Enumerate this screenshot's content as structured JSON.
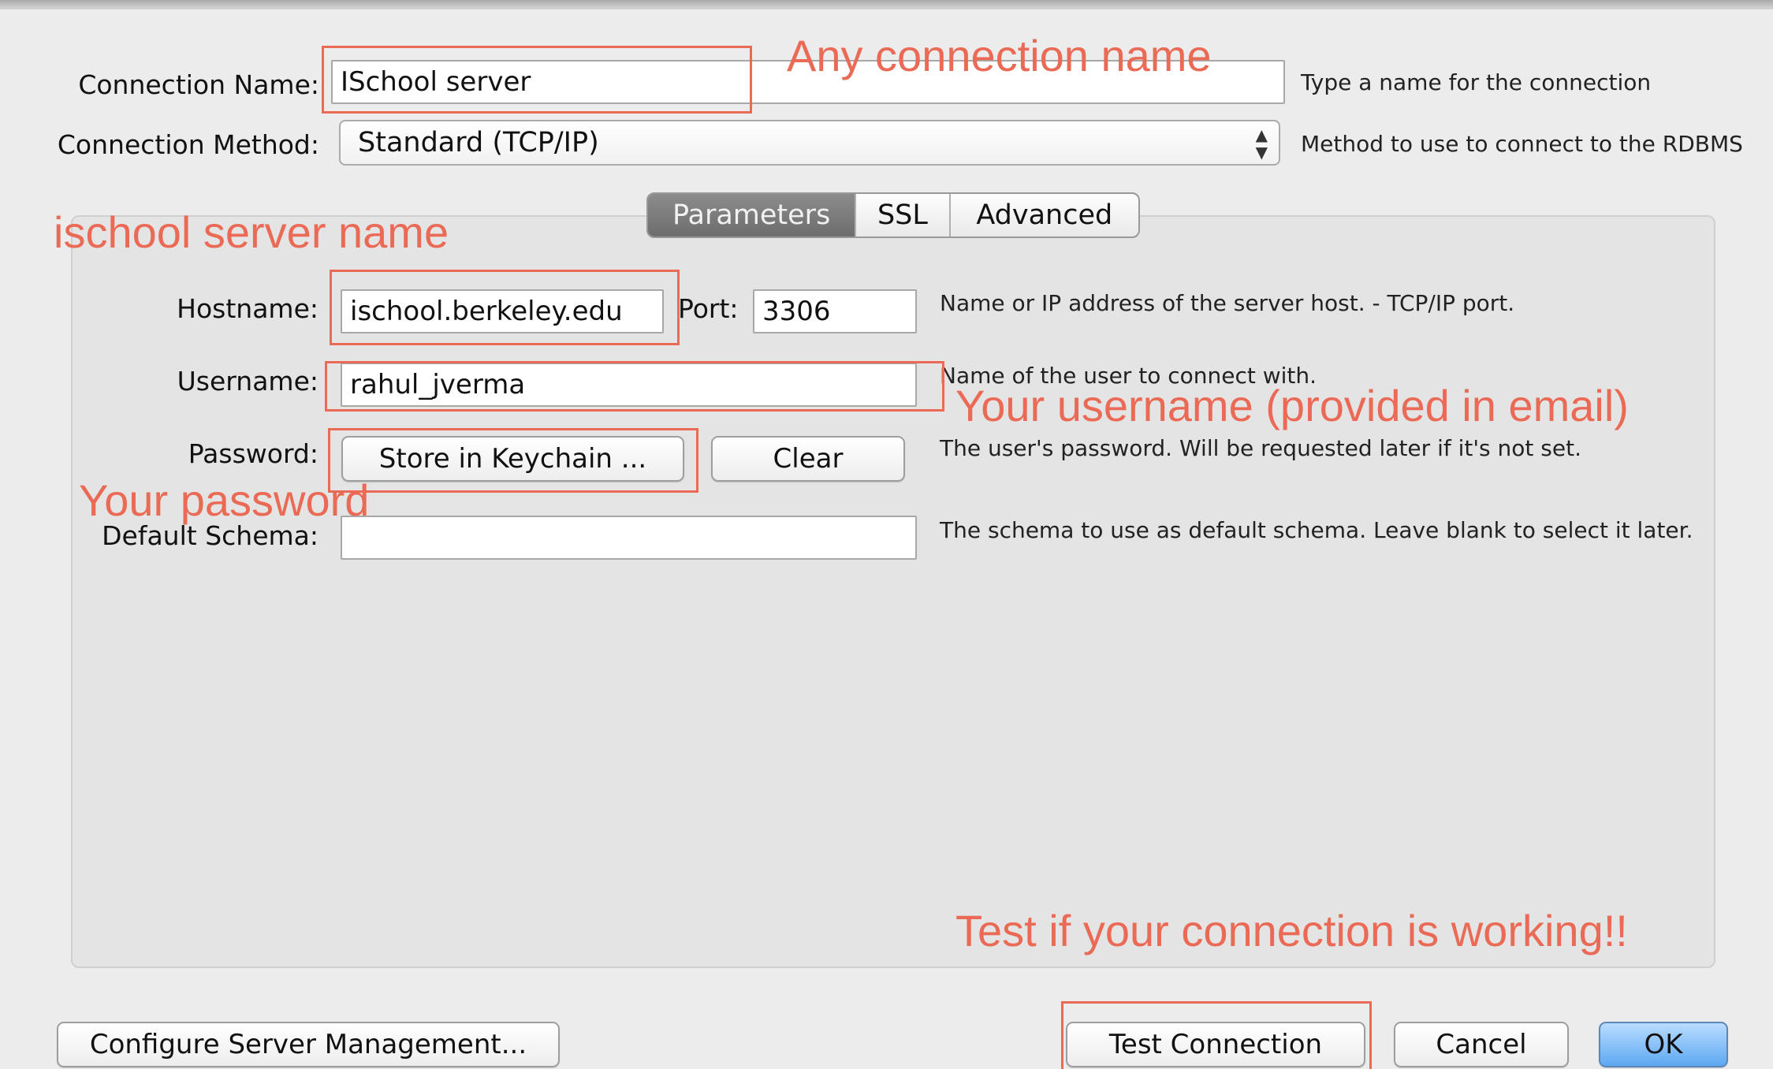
{
  "dialog": {
    "connection_name_label": "Connection Name:",
    "connection_name_value": "ISchool server",
    "connection_name_hint": "Type a name for the connection",
    "connection_method_label": "Connection Method:",
    "connection_method_value": "Standard (TCP/IP)",
    "connection_method_hint": "Method to use to connect to the RDBMS"
  },
  "tabs": [
    {
      "label": "Parameters",
      "active": true
    },
    {
      "label": "SSL",
      "active": false
    },
    {
      "label": "Advanced",
      "active": false
    }
  ],
  "params": {
    "hostname_label": "Hostname:",
    "hostname_value": "ischool.berkeley.edu",
    "port_label": "Port:",
    "port_value": "3306",
    "hostname_hint": "Name or IP address of the server host. - TCP/IP port.",
    "username_label": "Username:",
    "username_value": "rahul_jverma",
    "username_hint": "Name of the user to connect with.",
    "password_label": "Password:",
    "store_keychain_label": "Store in Keychain ...",
    "clear_label": "Clear",
    "password_hint": "The user's password. Will be requested later if it's not set.",
    "default_schema_label": "Default Schema:",
    "default_schema_value": "",
    "default_schema_hint": "The schema to use as default schema. Leave blank to select it later."
  },
  "footer": {
    "configure_label": "Configure Server Management...",
    "test_label": "Test Connection",
    "cancel_label": "Cancel",
    "ok_label": "OK"
  },
  "annotations": {
    "connection_name": "Any connection name",
    "server_name": "ischool server name",
    "username": "Your username (provided in email)",
    "password": "Your password",
    "test": "Test if your connection is working!!"
  },
  "colors": {
    "annotation": "#ea6a55",
    "ok_button": "#5ea8f2",
    "active_tab": "#7a7a7a"
  }
}
